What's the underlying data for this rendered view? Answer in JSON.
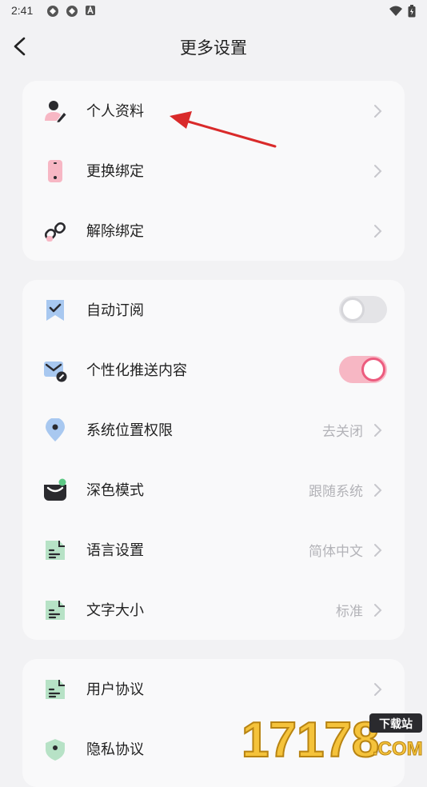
{
  "status_bar": {
    "time": "2:41",
    "notification_icons": [
      "sync-icon",
      "sync-icon",
      "a-badge-icon"
    ],
    "system_icons": [
      "wifi-icon",
      "battery-charging-icon"
    ]
  },
  "header": {
    "title": "更多设置",
    "back_icon": "chevron-left-icon"
  },
  "sections": [
    {
      "items": [
        {
          "label": "个人资料",
          "icon": "user-edit-icon"
        },
        {
          "label": "更换绑定",
          "icon": "phone-icon"
        },
        {
          "label": "解除绑定",
          "icon": "unlink-icon"
        }
      ]
    },
    {
      "items": [
        {
          "label": "自动订阅",
          "icon": "bookmark-check-icon",
          "toggle": false
        },
        {
          "label": "个性化推送内容",
          "icon": "mail-settings-icon",
          "toggle": true
        },
        {
          "label": "系统位置权限",
          "icon": "location-pin-icon",
          "value": "去关闭"
        },
        {
          "label": "深色模式",
          "icon": "dark-mode-icon",
          "value": "跟随系统"
        },
        {
          "label": "语言设置",
          "icon": "document-icon",
          "value": "简体中文"
        },
        {
          "label": "文字大小",
          "icon": "document-icon",
          "value": "标准"
        }
      ]
    },
    {
      "items": [
        {
          "label": "用户协议",
          "icon": "document-icon"
        },
        {
          "label": "隐私协议",
          "icon": "shield-icon"
        }
      ]
    }
  ],
  "colors": {
    "pink": "#f7b7c4",
    "accent_pink": "#ec5b7e",
    "blue": "#a8c8f0",
    "green": "#b7e2c6",
    "annotation_arrow": "#d92a2a"
  },
  "watermark": {
    "text": "17178",
    "badge": "下载站",
    "suffix": ".COM"
  }
}
